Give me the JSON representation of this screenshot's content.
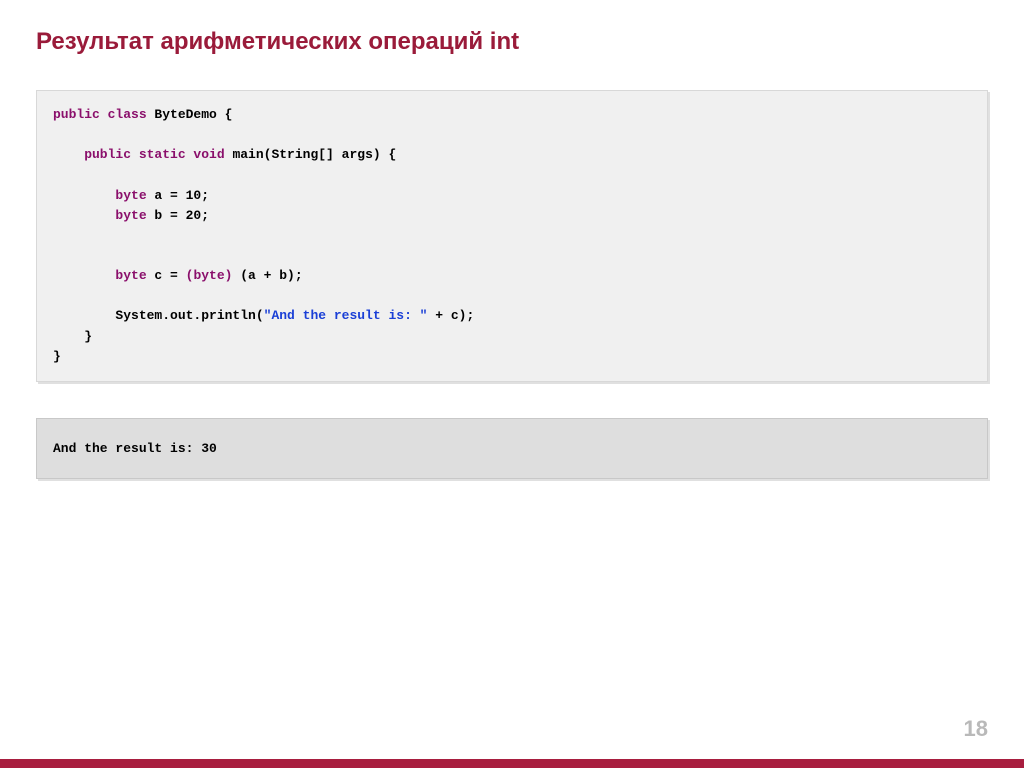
{
  "title": "Результат арифметических операций int",
  "code": {
    "l1_kw1": "public class",
    "l1_name": " ByteDemo {",
    "l2": "",
    "l3_kw": "    public static void",
    "l3_rest": " main(String[] args) {",
    "l4": "",
    "l5_kw": "        byte",
    "l5_rest": " a = 10;",
    "l6_kw": "        byte",
    "l6_rest": " b = 20;",
    "l7": "",
    "l8": "",
    "l9_kw": "        byte",
    "l9_mid": " c = ",
    "l9_cast": "(byte)",
    "l9_rest": " (a + b);",
    "l10": "",
    "l11_pre": "        System.out.println(",
    "l11_str": "\"And the result is: \"",
    "l11_post": " + c);",
    "l12": "    }",
    "l13": "}"
  },
  "output": "And the result is: 30",
  "page_number": "18"
}
